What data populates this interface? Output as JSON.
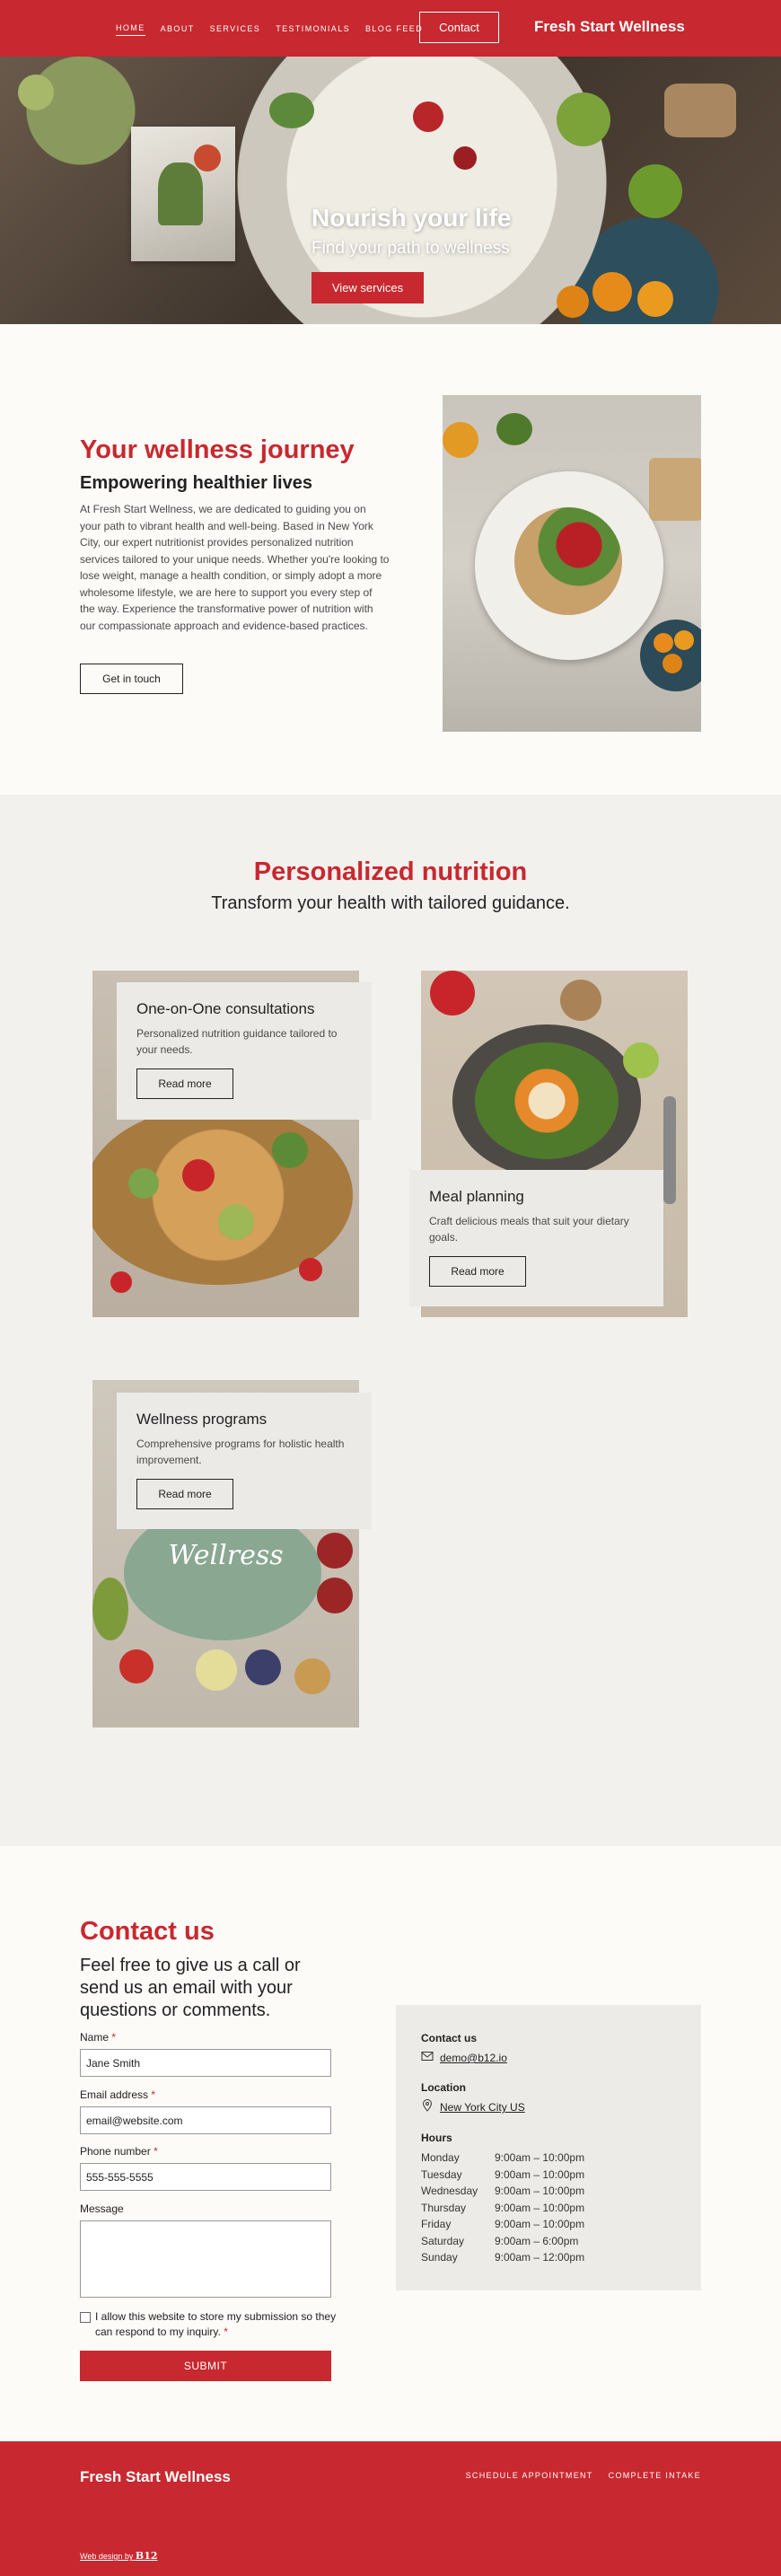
{
  "header": {
    "nav": [
      "HOME",
      "ABOUT",
      "SERVICES",
      "TESTIMONIALS",
      "BLOG FEED"
    ],
    "contact_button": "Contact",
    "brand": "Fresh Start Wellness"
  },
  "hero": {
    "title": "Nourish your life",
    "subtitle": "Find your path to wellness",
    "button": "View services"
  },
  "journey": {
    "title": "Your wellness journey",
    "subtitle": "Empowering healthier lives",
    "body": "At Fresh Start Wellness, we are dedicated to guiding you on your path to vibrant health and well-being. Based in New York City, our expert nutritionist provides personalized nutrition services tailored to your unique needs. Whether you're looking to lose weight, manage a health condition, or simply adopt a more wholesome lifestyle, we are here to support you every step of the way. Experience the transformative power of nutrition with our compassionate approach and evidence-based practices.",
    "button": "Get in touch"
  },
  "services": {
    "title": "Personalized nutrition",
    "subtitle": "Transform your health with tailored guidance.",
    "cards": [
      {
        "title": "One-on-One consultations",
        "text": "Personalized nutrition guidance tailored to your needs.",
        "button": "Read more"
      },
      {
        "title": "Meal planning",
        "text": "Craft delicious meals that suit your dietary goals.",
        "button": "Read more"
      },
      {
        "title": "Wellness programs",
        "text": "Comprehensive programs for holistic health improvement.",
        "button": "Read more"
      }
    ],
    "wellness_photo_text": "Wellress"
  },
  "contact": {
    "title": "Contact us",
    "subtitle": "Feel free to give us a call or send us an email with your questions or comments.",
    "fields": {
      "name_label": "Name",
      "name_value": "Jane Smith",
      "email_label": "Email address",
      "email_value": "email@website.com",
      "phone_label": "Phone number",
      "phone_value": "555-555-5555",
      "message_label": "Message",
      "message_value": ""
    },
    "required_mark": "*",
    "consent": "I allow this website to store my submission so they can respond to my inquiry.",
    "submit": "SUBMIT",
    "info": {
      "contact_heading": "Contact us",
      "email": "demo@b12.io",
      "location_heading": "Location",
      "location": "New York City US",
      "hours_heading": "Hours",
      "hours": [
        {
          "day": "Monday",
          "time": "9:00am  –  10:00pm"
        },
        {
          "day": "Tuesday",
          "time": "9:00am  –  10:00pm"
        },
        {
          "day": "Wednesday",
          "time": "9:00am  –  10:00pm"
        },
        {
          "day": "Thursday",
          "time": "9:00am  –  10:00pm"
        },
        {
          "day": "Friday",
          "time": "9:00am  –  10:00pm"
        },
        {
          "day": "Saturday",
          "time": "9:00am  –  6:00pm"
        },
        {
          "day": "Sunday",
          "time": "9:00am  –  12:00pm"
        }
      ]
    }
  },
  "footer": {
    "brand": "Fresh Start Wellness",
    "links": [
      "SCHEDULE APPOINTMENT",
      "COMPLETE INTAKE"
    ],
    "credit_prefix": "Web design by",
    "credit_logo": "B12"
  },
  "colors": {
    "brand_red": "#c8282f",
    "page_bg": "#fcfbf8",
    "section_bg": "#f3f1ee",
    "card_bg": "#ebeae6"
  }
}
